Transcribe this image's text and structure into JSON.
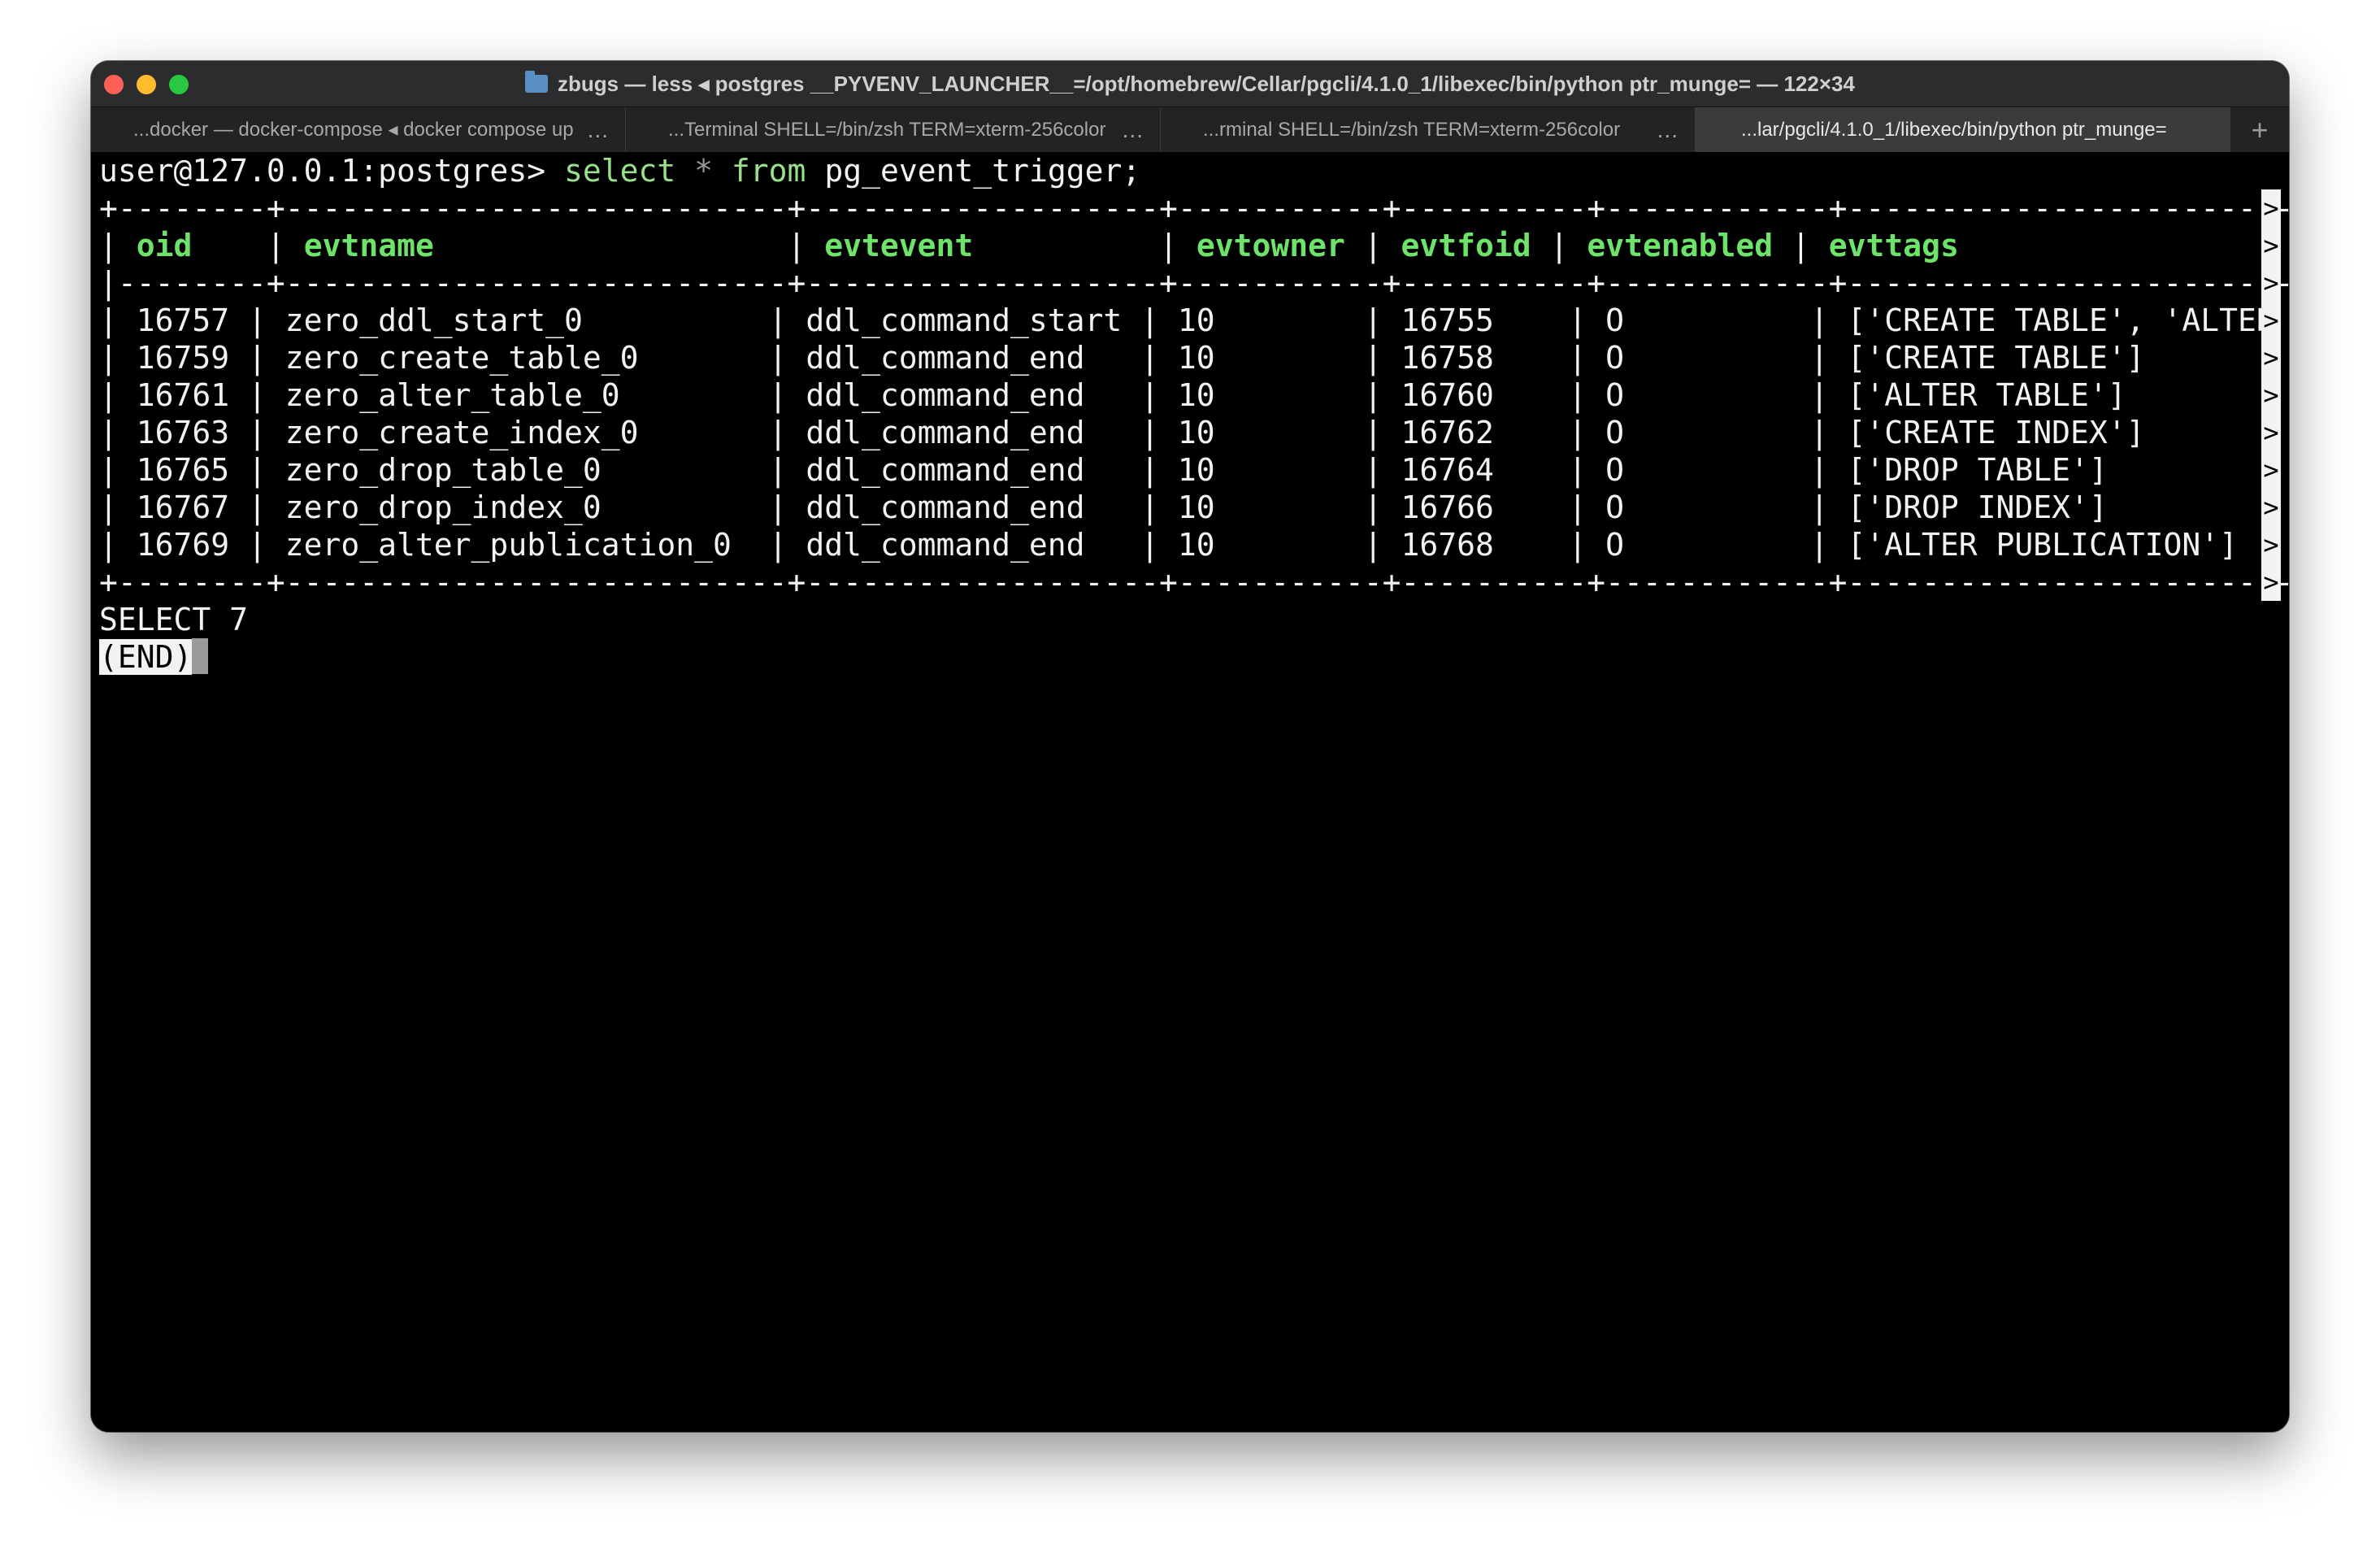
{
  "window": {
    "title": "zbugs — less ◂ postgres __PYVENV_LAUNCHER__=/opt/homebrew/Cellar/pgcli/4.1.0_1/libexec/bin/python ptr_munge= — 122×34"
  },
  "tabs": [
    {
      "label": "...docker — docker-compose ◂ docker compose up",
      "more": "..."
    },
    {
      "label": "...Terminal SHELL=/bin/zsh TERM=xterm-256color",
      "more": "..."
    },
    {
      "label": "...rminal SHELL=/bin/zsh TERM=xterm-256color",
      "more": "..."
    },
    {
      "label": "...lar/pgcli/4.1.0_1/libexec/bin/python ptr_munge=",
      "more": ""
    }
  ],
  "new_tab_label": "+",
  "terminal": {
    "prompt": "user@127.0.0.1:postgres> ",
    "kw_select": "select",
    "kw_star": "*",
    "kw_from": "from",
    "table_name": "pg_event_trigger;",
    "border_top": "+--------+---------------------------+-------------------+-----------+----------+------------+-----------------------------",
    "header_parts": [
      "| ",
      "oid",
      "    | ",
      "evtname",
      "                   | ",
      "evtevent",
      "          | ",
      "evtowner",
      " | ",
      "evtfoid",
      " | ",
      "evtenabled",
      " | ",
      "evttags"
    ],
    "border_mid": "|--------+---------------------------+-------------------+-----------+----------+------------+-----------------------------",
    "rows": [
      "| 16757 | zero_ddl_start_0          | ddl_command_start | 10        | 16755    | O          | ['CREATE TABLE', 'ALTER TABLE'",
      "| 16759 | zero_create_table_0       | ddl_command_end   | 10        | 16758    | O          | ['CREATE TABLE']",
      "| 16761 | zero_alter_table_0        | ddl_command_end   | 10        | 16760    | O          | ['ALTER TABLE']",
      "| 16763 | zero_create_index_0       | ddl_command_end   | 10        | 16762    | O          | ['CREATE INDEX']",
      "| 16765 | zero_drop_table_0         | ddl_command_end   | 10        | 16764    | O          | ['DROP TABLE']",
      "| 16767 | zero_drop_index_0         | ddl_command_end   | 10        | 16766    | O          | ['DROP INDEX']",
      "| 16769 | zero_alter_publication_0  | ddl_command_end   | 10        | 16768    | O          | ['ALTER PUBLICATION']"
    ],
    "border_bottom": "+--------+---------------------------+-------------------+-----------+----------+------------+-----------------------------",
    "truncation_mark": ">",
    "result": "SELECT 7",
    "end_marker": "(END)"
  }
}
